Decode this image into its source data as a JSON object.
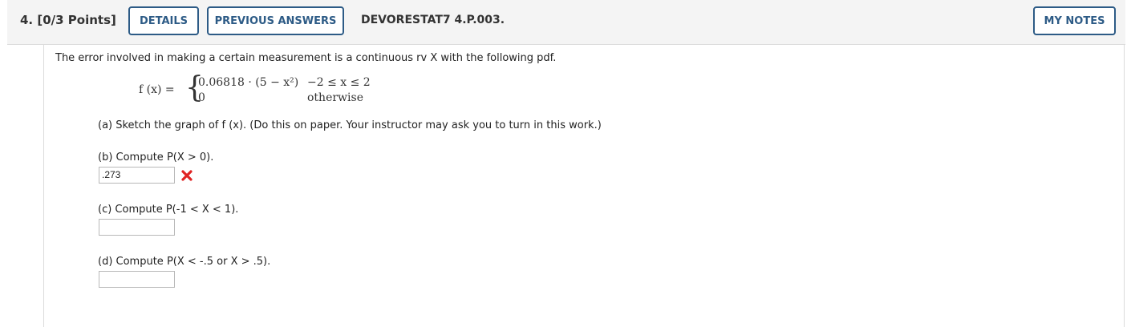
{
  "header": {
    "question_number": "4.",
    "points": "[0/3 Points]",
    "details_label": "DETAILS",
    "previous_answers_label": "PREVIOUS ANSWERS",
    "question_code": "DEVORESTAT7 4.P.003.",
    "my_notes_label": "MY NOTES"
  },
  "question": {
    "intro": "The error involved in making a certain measurement is a continuous rv X with the following pdf.",
    "formula": {
      "lhs": "f (x) =",
      "case1_expr": "0.06818 · (5 − x²)",
      "case1_cond": "−2 ≤ x ≤ 2",
      "case2_expr": "0",
      "case2_cond": "otherwise"
    },
    "part_a": "(a) Sketch the graph of f (x). (Do this on paper. Your instructor may ask you to turn in this work.)",
    "part_b": "(b) Compute P(X > 0).",
    "part_c": "(c) Compute P(-1 < X < 1).",
    "part_d": "(d) Compute P(X < -.5 or X > .5)."
  },
  "answers": {
    "b_value": ".273",
    "b_status": "incorrect",
    "c_value": "",
    "d_value": ""
  },
  "icons": {
    "wrong": "wrong-x-icon"
  },
  "colors": {
    "accent": "#2d5b86",
    "wrong": "#e02424",
    "header_bg": "#f4f4f4"
  }
}
